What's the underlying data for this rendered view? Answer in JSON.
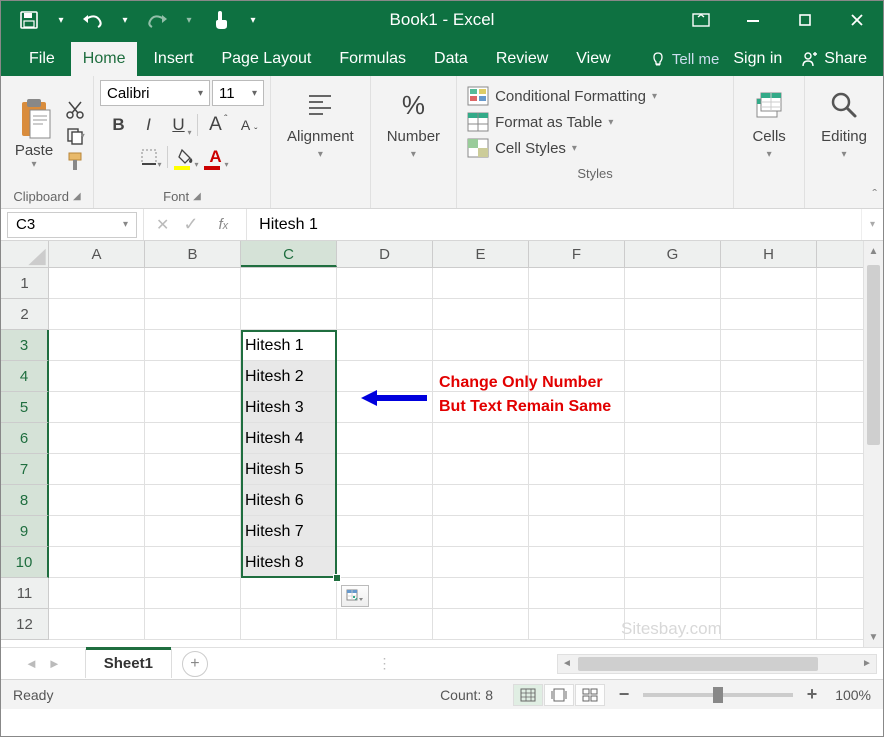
{
  "titlebar": {
    "title": "Book1 - Excel"
  },
  "tabs": {
    "file": "File",
    "home": "Home",
    "insert": "Insert",
    "pageLayout": "Page Layout",
    "formulas": "Formulas",
    "data": "Data",
    "review": "Review",
    "view": "View",
    "tellMe": "Tell me",
    "signIn": "Sign in",
    "share": "Share"
  },
  "ribbon": {
    "clipboard": {
      "paste": "Paste",
      "label": "Clipboard"
    },
    "font": {
      "name": "Calibri",
      "size": "11",
      "label": "Font",
      "bold": "B",
      "italic": "I",
      "underline": "U",
      "bigA": "A",
      "smallA": "A"
    },
    "alignment": {
      "label": "Alignment"
    },
    "number": {
      "label": "Number",
      "pct": "%"
    },
    "styles": {
      "conditional": "Conditional Formatting",
      "table": "Format as Table",
      "cellStyles": "Cell Styles",
      "label": "Styles"
    },
    "cells": {
      "label": "Cells"
    },
    "editing": {
      "label": "Editing"
    }
  },
  "fxbar": {
    "nameBox": "C3",
    "formula": "Hitesh 1"
  },
  "grid": {
    "cols": [
      "A",
      "B",
      "C",
      "D",
      "E",
      "F",
      "G",
      "H"
    ],
    "rows": [
      "1",
      "2",
      "3",
      "4",
      "5",
      "6",
      "7",
      "8",
      "9",
      "10",
      "11",
      "12"
    ],
    "selectedCol": "C",
    "selectedRows": [
      "3",
      "4",
      "5",
      "6",
      "7",
      "8",
      "9",
      "10"
    ],
    "data_c": [
      "Hitesh 1",
      "Hitesh 2",
      "Hitesh 3",
      "Hitesh 4",
      "Hitesh 5",
      "Hitesh 6",
      "Hitesh 7",
      "Hitesh 8"
    ]
  },
  "annotation": {
    "line1": "Change Only Number",
    "line2": "But Text Remain Same"
  },
  "watermark": "Sitesbay.com",
  "sheets": {
    "active": "Sheet1"
  },
  "statusbar": {
    "ready": "Ready",
    "count": "Count: 8",
    "zoom": "100%"
  }
}
